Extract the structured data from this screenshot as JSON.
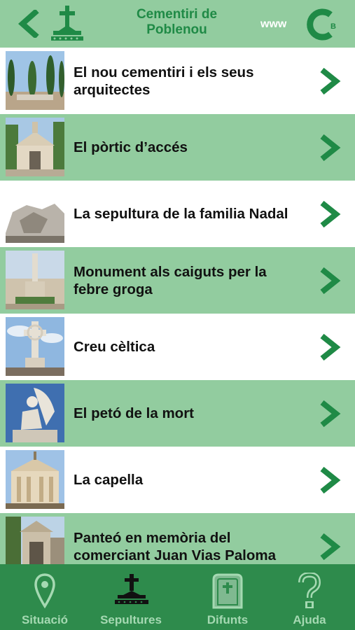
{
  "header": {
    "title_line1": "Cementiri de",
    "title_line2": "Poblenou",
    "www_label": "www",
    "brand_mark": "B"
  },
  "colors": {
    "accent": "#1f8a46",
    "row_green": "#92cc9f",
    "tabbar": "#2e8b4c",
    "tab_text": "#a5d9b2"
  },
  "list": {
    "items": [
      {
        "label": "El nou cementiri i els seus arquitectes",
        "icon": "cypress-trees-photo"
      },
      {
        "label": "El pòrtic d’accés",
        "icon": "portico-photo"
      },
      {
        "label": "La sepultura de la familia Nadal",
        "icon": "sculpture-photo"
      },
      {
        "label": "Monument als caiguts per la febre groga",
        "icon": "monument-photo"
      },
      {
        "label": "Creu cèltica",
        "icon": "celtic-cross-photo"
      },
      {
        "label": "El petó de la mort",
        "icon": "angel-statue-photo"
      },
      {
        "label": "La capella",
        "icon": "chapel-photo"
      },
      {
        "label": "Panteó en memòria del comerciant Juan Vias Paloma",
        "icon": "pantheon-photo"
      }
    ]
  },
  "tabbar": {
    "tabs": [
      {
        "label": "Situació",
        "icon": "map-pin-icon"
      },
      {
        "label": "Sepultures",
        "icon": "grave-cross-icon"
      },
      {
        "label": "Difunts",
        "icon": "tombstone-icon"
      },
      {
        "label": "Ajuda",
        "icon": "question-mark-icon"
      }
    ]
  }
}
